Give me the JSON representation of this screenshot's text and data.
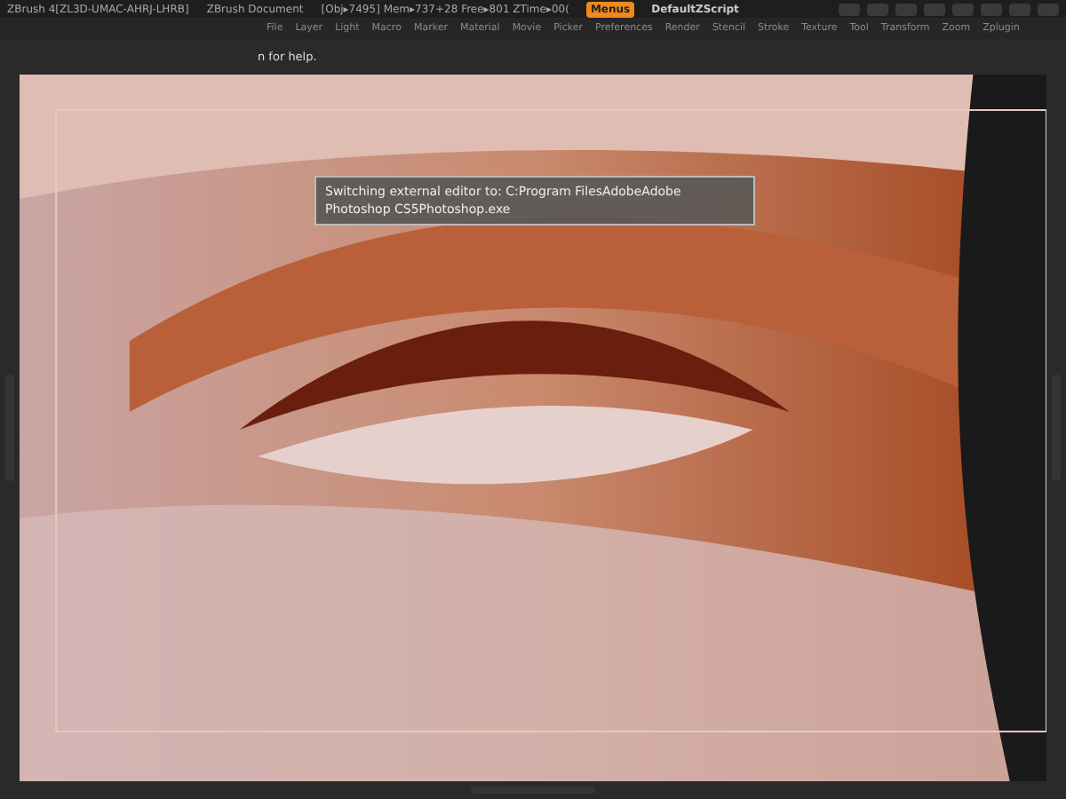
{
  "title_bar": {
    "app": "ZBrush 4[ZL3D-UMAC-AHRJ-LHRB]",
    "document": "ZBrush Document",
    "stats": "[Obj▸7495] Mem▸737+28 Free▸801 ZTime▸00(",
    "menus_button": "Menus",
    "script": "DefaultZScript"
  },
  "menu_bar": [
    "File",
    "Layer",
    "Light",
    "Macro",
    "Marker",
    "Material",
    "Movie",
    "Picker",
    "Preferences",
    "Render",
    "Stencil",
    "Stroke",
    "Texture",
    "Tool",
    "Transform",
    "Zoom",
    "Zplugin"
  ],
  "help_line": "n for help.",
  "canvas": {
    "kind": "picture",
    "notice": "Switching external editor to: C:Program FilesAdobeAdobe Photoshop CS5Photoshop.exe"
  }
}
